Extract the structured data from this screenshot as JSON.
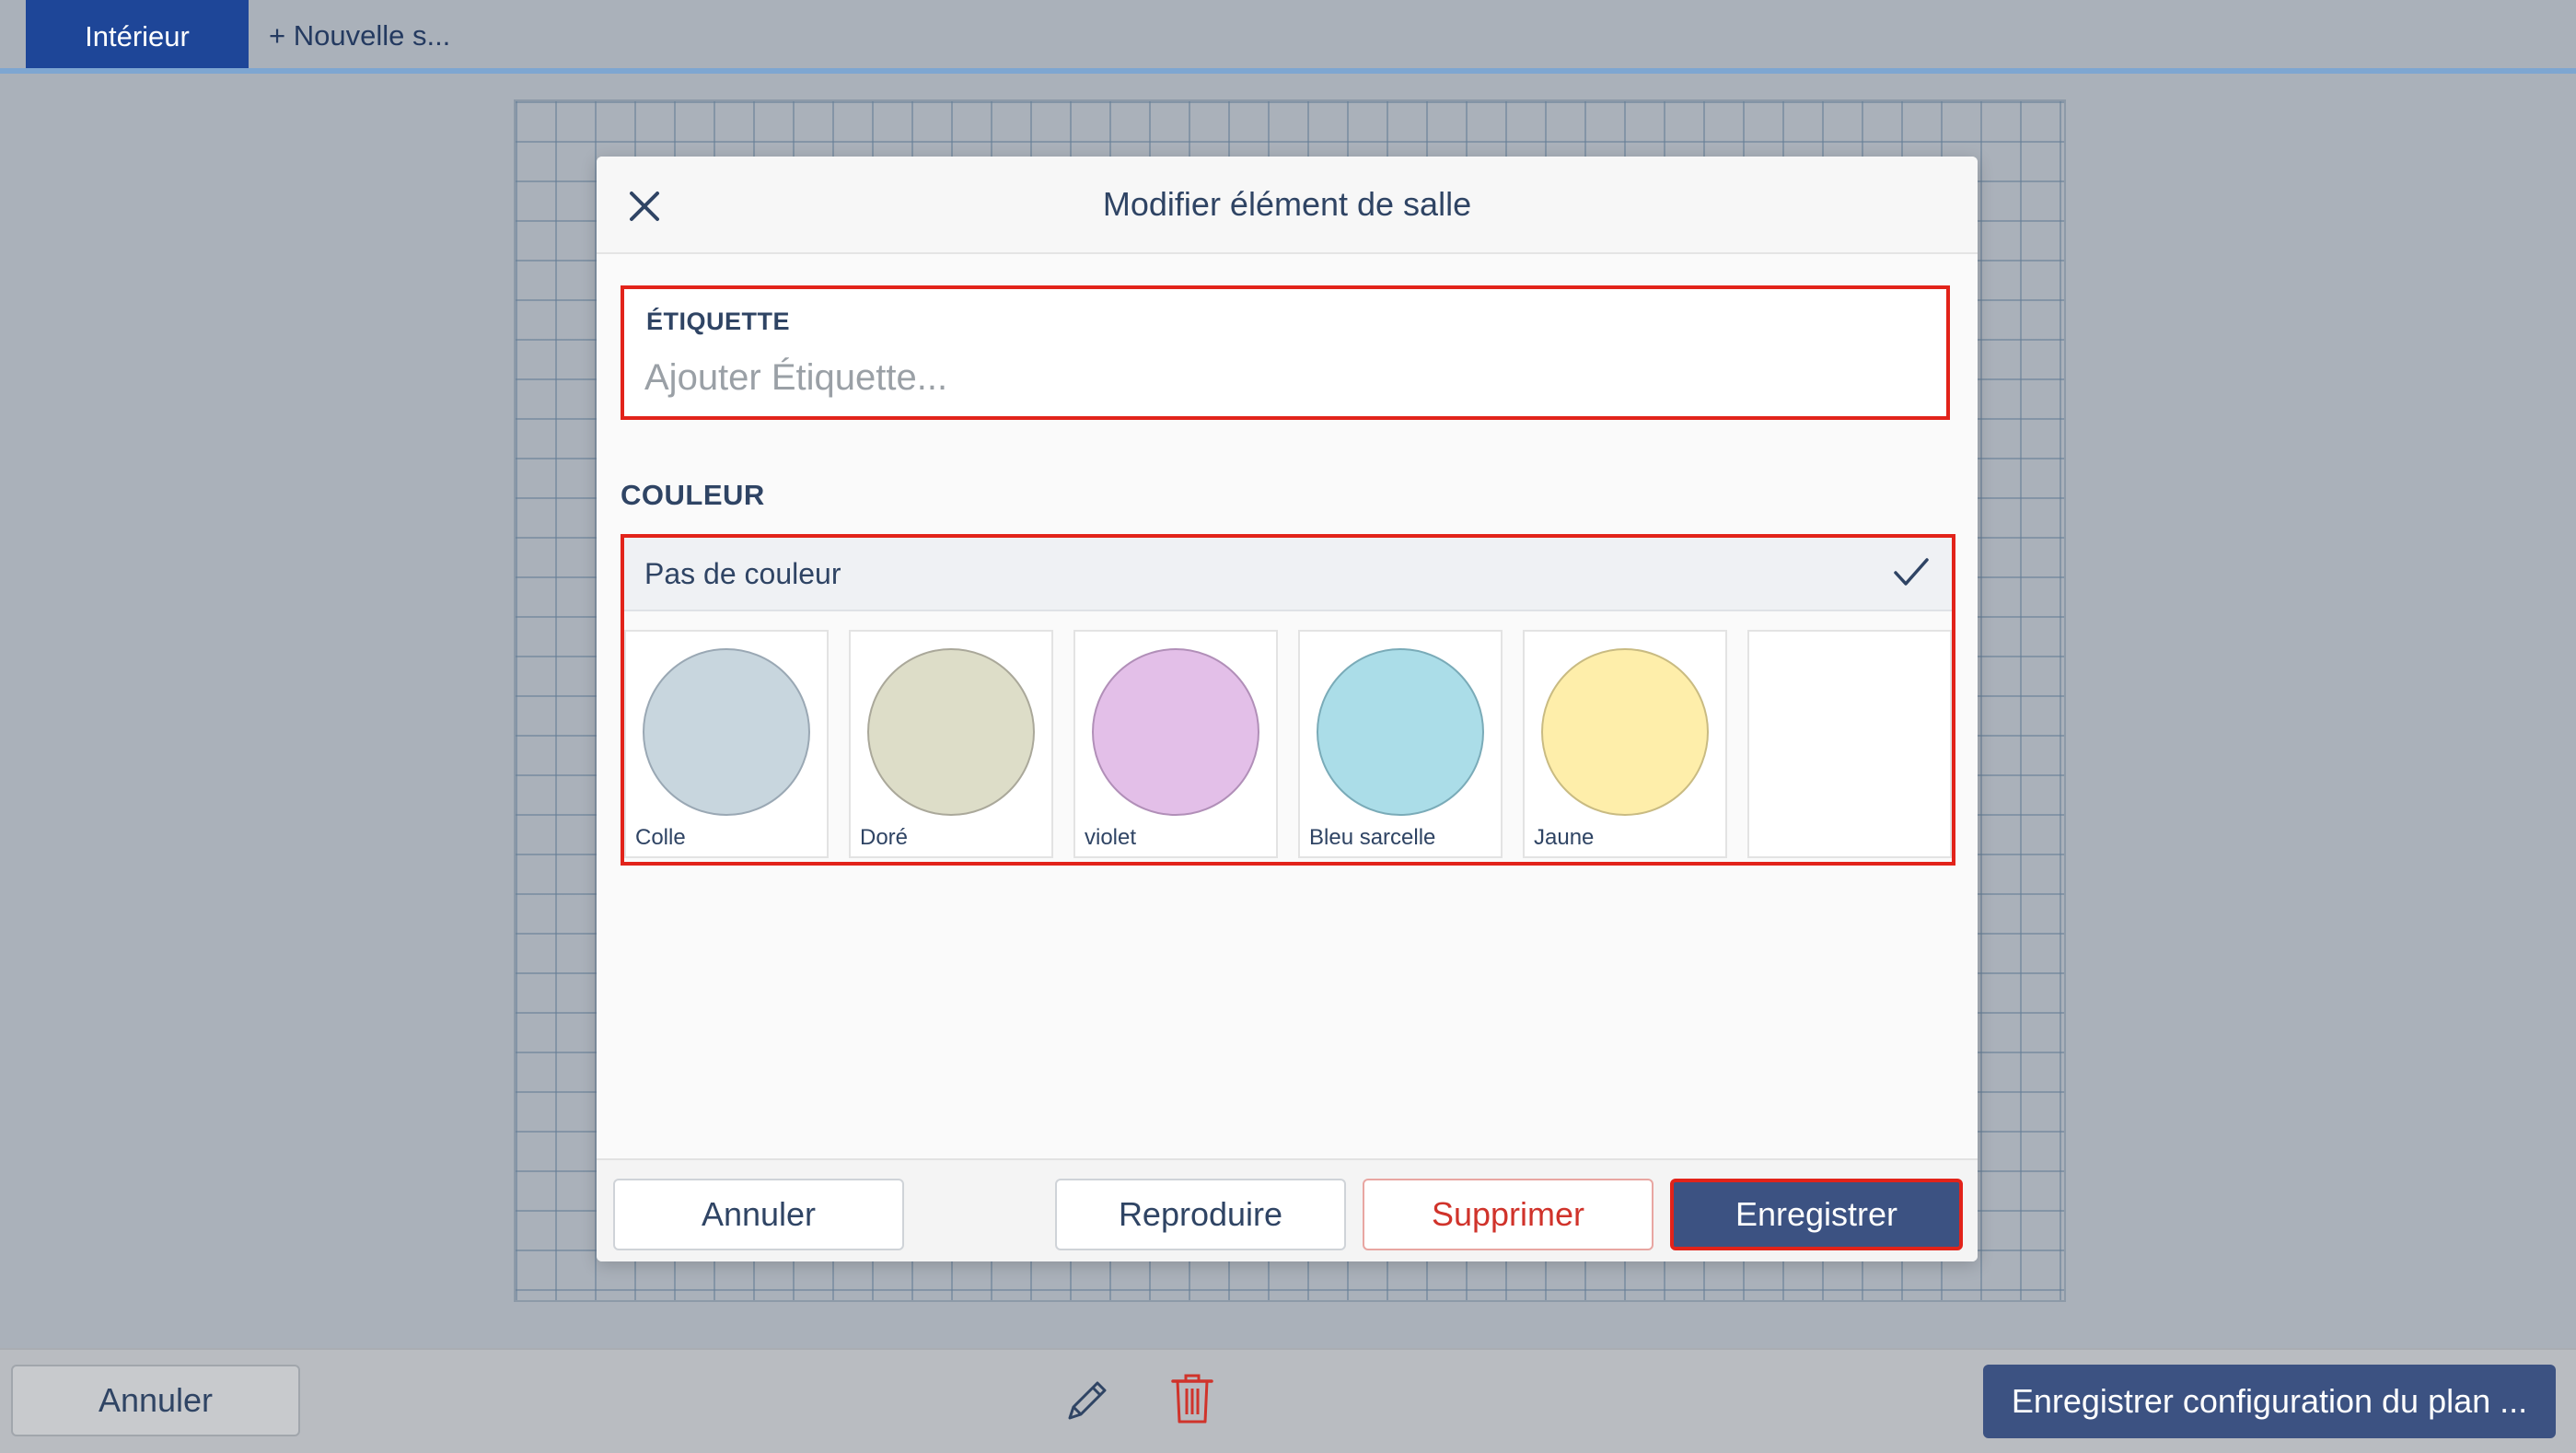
{
  "tabs": {
    "active_label": "Intérieur",
    "new_label": "+ Nouvelle s..."
  },
  "modal": {
    "title": "Modifier élément de salle",
    "label_section": {
      "caption": "ÉTIQUETTE",
      "value": "",
      "placeholder": "Ajouter Étiquette..."
    },
    "color_section": {
      "title": "COULEUR",
      "no_color_label": "Pas de couleur",
      "no_color_selected": true,
      "swatches": [
        {
          "name": "Colle",
          "fill": "#c8d6de",
          "border": "#9aa8b4"
        },
        {
          "name": "Doré",
          "fill": "#ddddc8",
          "border": "#aaa89a"
        },
        {
          "name": "violet",
          "fill": "#e3bfe8",
          "border": "#b18fb8"
        },
        {
          "name": "Bleu sarcelle",
          "fill": "#abdde8",
          "border": "#7aabb8"
        },
        {
          "name": "Jaune",
          "fill": "#feeeaa",
          "border": "#c9bb82"
        }
      ]
    },
    "footer": {
      "cancel_label": "Annuler",
      "duplicate_label": "Reproduire",
      "delete_label": "Supprimer",
      "save_label": "Enregistrer"
    }
  },
  "bottombar": {
    "cancel_label": "Annuler",
    "edit_icon": "pencil-icon",
    "trash_icon": "trash-icon",
    "save_label": "Enregistrer configuration du plan ..."
  },
  "colors": {
    "accent_blue": "#1e4698",
    "primary_button": "#3c5282",
    "highlight_red": "#e2231a",
    "delete_red": "#d0332b"
  }
}
